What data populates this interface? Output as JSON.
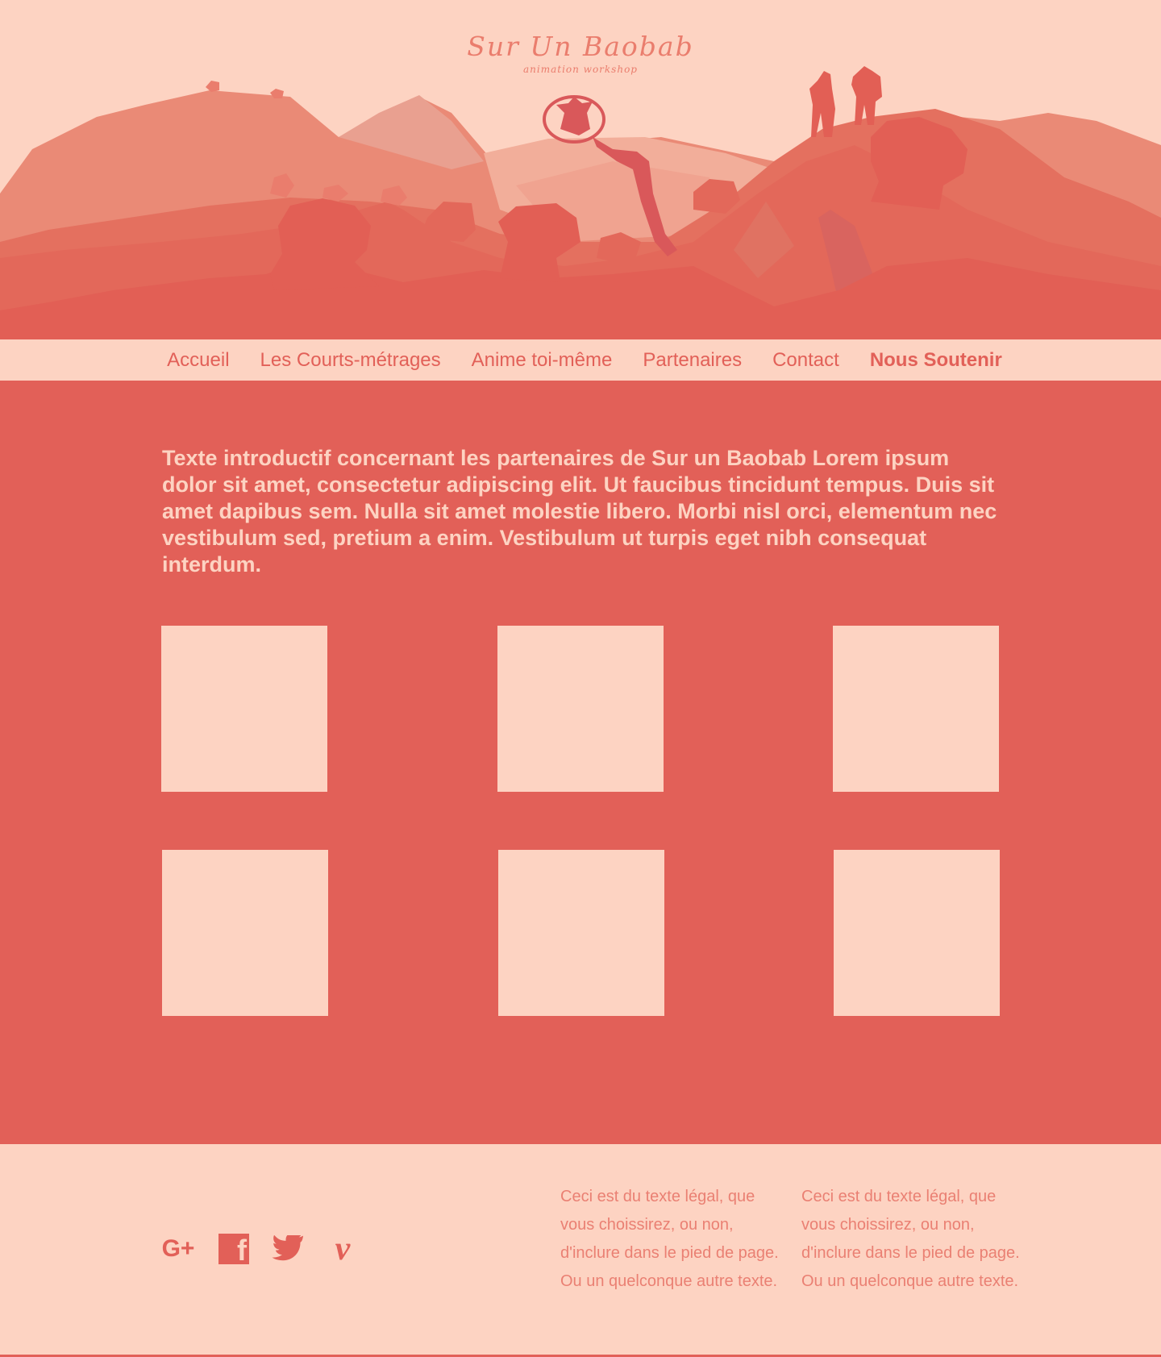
{
  "brand": {
    "title": "Sur Un Baobab",
    "subtitle": "animation workshop"
  },
  "nav": {
    "items": [
      {
        "label": "Accueil"
      },
      {
        "label": "Les Courts-métrages"
      },
      {
        "label": "Anime toi-même"
      },
      {
        "label": "Partenaires"
      },
      {
        "label": "Contact"
      },
      {
        "label": "Nous Soutenir"
      }
    ]
  },
  "main": {
    "intro": "Texte introductif concernant les partenaires de Sur un Baobab Lorem ipsum dolor sit amet, consectetur adipiscing elit. Ut faucibus tincidunt tempus. Duis sit amet dapibus sem. Nulla sit amet molestie libero. Morbi nisl orci, elementum nec vestibulum sed, pretium a enim. Vestibulum ut turpis eget nibh consequat interdum.",
    "partner_tiles": 6
  },
  "footer": {
    "socials": [
      {
        "icon": "google-plus-icon",
        "glyph": "G+"
      },
      {
        "icon": "facebook-icon",
        "glyph": "f"
      },
      {
        "icon": "twitter-icon"
      },
      {
        "icon": "vimeo-icon",
        "glyph": "v"
      }
    ],
    "legal_1": "Ceci est du texte légal, que vous choissirez, ou non, d'inclure dans le pied de page. Ou un quelconque autre texte.",
    "legal_2": "Ceci est du texte légal, que vous choissirez, ou non, d'inclure dans le pied de page. Ou un quelconque autre texte."
  },
  "colors": {
    "background": "#fdd3c2",
    "accent": "#e26058",
    "hill_light": "#ea8a76",
    "hill_mid": "#e4705f"
  }
}
